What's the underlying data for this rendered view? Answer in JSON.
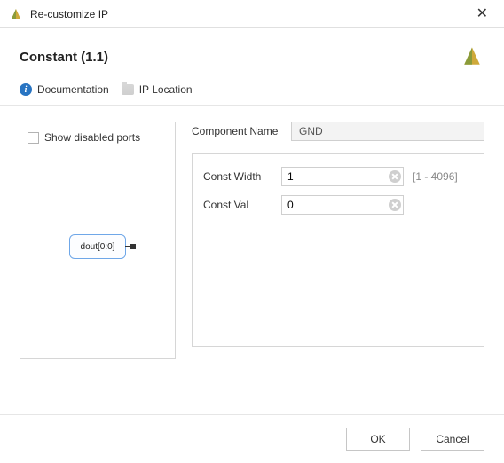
{
  "window": {
    "title": "Re-customize IP"
  },
  "header": {
    "title": "Constant (1.1)"
  },
  "toolbar": {
    "documentation_label": "Documentation",
    "ip_location_label": "IP Location"
  },
  "left": {
    "show_disabled_label": "Show disabled ports",
    "block_port_label": "dout[0:0]"
  },
  "right": {
    "component_name_label": "Component Name",
    "component_name_value": "GND",
    "props": [
      {
        "label": "Const Width",
        "value": "1",
        "range": "[1 - 4096]"
      },
      {
        "label": "Const Val",
        "value": "0",
        "range": ""
      }
    ]
  },
  "footer": {
    "ok_label": "OK",
    "cancel_label": "Cancel"
  }
}
